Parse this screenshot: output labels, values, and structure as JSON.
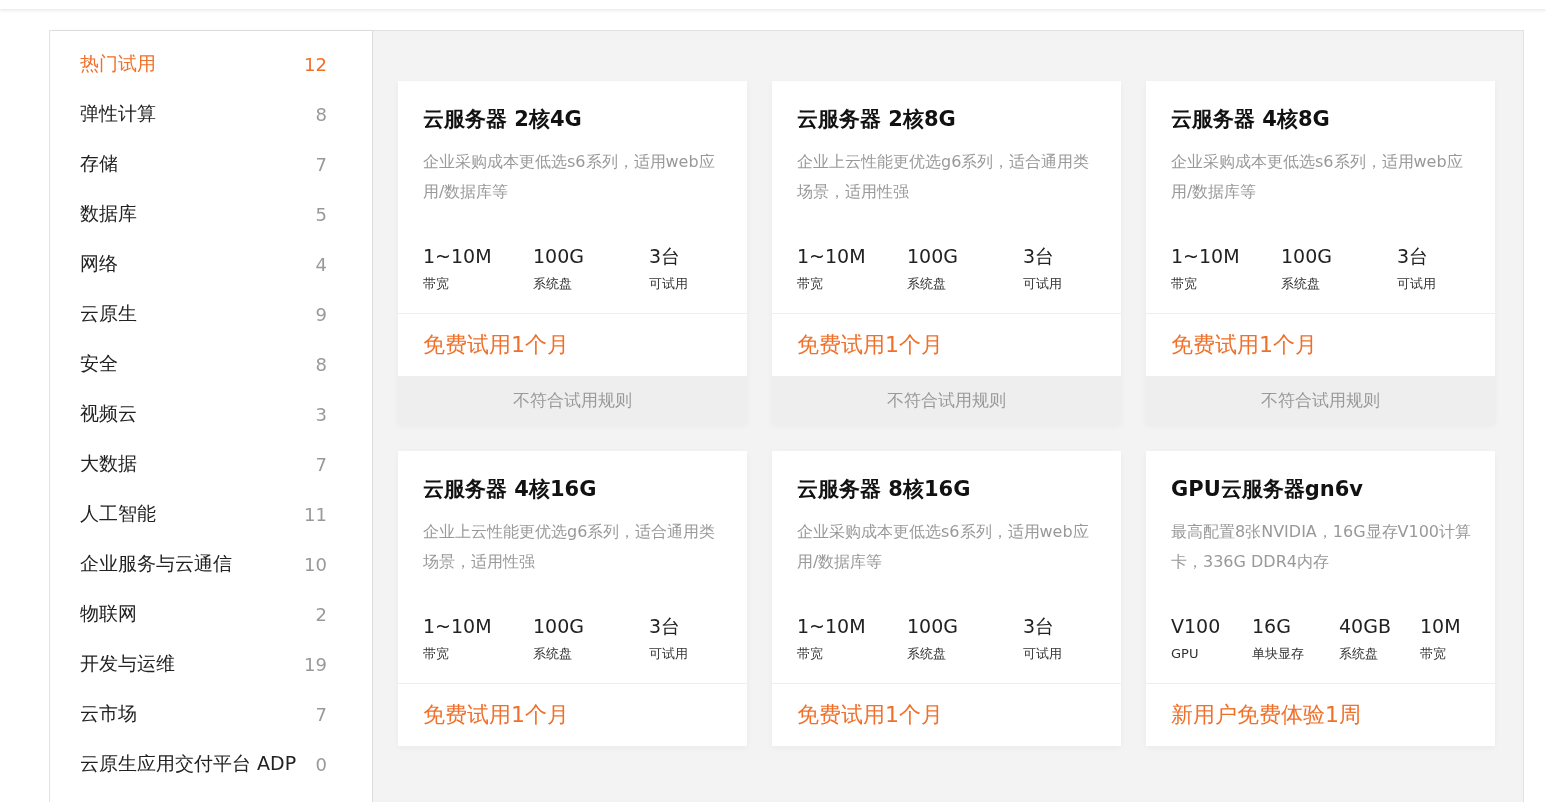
{
  "categories": [
    {
      "label": "热门试用",
      "count": "12",
      "selected": true
    },
    {
      "label": "弹性计算",
      "count": "8",
      "selected": false
    },
    {
      "label": "存储",
      "count": "7",
      "selected": false
    },
    {
      "label": "数据库",
      "count": "5",
      "selected": false
    },
    {
      "label": "网络",
      "count": "4",
      "selected": false
    },
    {
      "label": "云原生",
      "count": "9",
      "selected": false
    },
    {
      "label": "安全",
      "count": "8",
      "selected": false
    },
    {
      "label": "视频云",
      "count": "3",
      "selected": false
    },
    {
      "label": "大数据",
      "count": "7",
      "selected": false
    },
    {
      "label": "人工智能",
      "count": "11",
      "selected": false
    },
    {
      "label": "企业服务与云通信",
      "count": "10",
      "selected": false
    },
    {
      "label": "物联网",
      "count": "2",
      "selected": false
    },
    {
      "label": "开发与运维",
      "count": "19",
      "selected": false
    },
    {
      "label": "云市场",
      "count": "7",
      "selected": false
    },
    {
      "label": "云原生应用交付平台 ADP",
      "count": "0",
      "selected": false
    }
  ],
  "products": [
    {
      "title": "云服务器 2核4G",
      "description": "企业采购成本更低选s6系列，适用web应用/数据库等",
      "specs": [
        {
          "value": "1~10M",
          "label": "带宽"
        },
        {
          "value": "100G",
          "label": "系统盘"
        },
        {
          "value": "3台",
          "label": "可试用"
        }
      ],
      "offer": "免费试用1个月",
      "button": "不符合试用规则"
    },
    {
      "title": "云服务器 2核8G",
      "description": "企业上云性能更优选g6系列，适合通用类场景，适用性强",
      "specs": [
        {
          "value": "1~10M",
          "label": "带宽"
        },
        {
          "value": "100G",
          "label": "系统盘"
        },
        {
          "value": "3台",
          "label": "可试用"
        }
      ],
      "offer": "免费试用1个月",
      "button": "不符合试用规则"
    },
    {
      "title": "云服务器 4核8G",
      "description": "企业采购成本更低选s6系列，适用web应用/数据库等",
      "specs": [
        {
          "value": "1~10M",
          "label": "带宽"
        },
        {
          "value": "100G",
          "label": "系统盘"
        },
        {
          "value": "3台",
          "label": "可试用"
        }
      ],
      "offer": "免费试用1个月",
      "button": "不符合试用规则"
    },
    {
      "title": "云服务器 4核16G",
      "description": "企业上云性能更优选g6系列，适合通用类场景，适用性强",
      "specs": [
        {
          "value": "1~10M",
          "label": "带宽"
        },
        {
          "value": "100G",
          "label": "系统盘"
        },
        {
          "value": "3台",
          "label": "可试用"
        }
      ],
      "offer": "免费试用1个月"
    },
    {
      "title": "云服务器 8核16G",
      "description": "企业采购成本更低选s6系列，适用web应用/数据库等",
      "specs": [
        {
          "value": "1~10M",
          "label": "带宽"
        },
        {
          "value": "100G",
          "label": "系统盘"
        },
        {
          "value": "3台",
          "label": "可试用"
        }
      ],
      "offer": "免费试用1个月"
    },
    {
      "title": "GPU云服务器gn6v",
      "description": "最高配置8张NVIDIA，16G显存V100计算卡，336G DDR4内存",
      "specs": [
        {
          "value": "V100",
          "label": "GPU"
        },
        {
          "value": "16G",
          "label": "单块显存"
        },
        {
          "value": "40GB",
          "label": "系统盘"
        },
        {
          "value": "10M",
          "label": "带宽"
        }
      ],
      "offer": "新用户免费体验1周"
    }
  ]
}
